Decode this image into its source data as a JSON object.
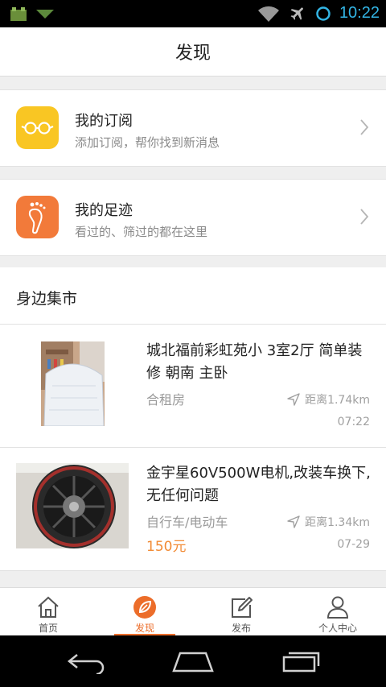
{
  "status_bar": {
    "time": "10:22"
  },
  "header": {
    "title": "发现"
  },
  "entries": [
    {
      "title": "我的订阅",
      "subtitle": "添加订阅，帮你找到新消息"
    },
    {
      "title": "我的足迹",
      "subtitle": "看过的、筛过的都在这里"
    }
  ],
  "section": {
    "title": "身边集市"
  },
  "listings": [
    {
      "title": "城北福前彩虹苑小 3室2厅 简单装修 朝南 主卧",
      "category": "合租房",
      "distance": "距离1.74km",
      "time": "07:22",
      "price": ""
    },
    {
      "title": "金宇星60V500W电机,改装车换下,无任何问题",
      "category": "自行车/电动车",
      "distance": "距离1.34km",
      "time": "07-29",
      "price": "150元"
    }
  ],
  "tabs": [
    {
      "label": "首页"
    },
    {
      "label": "发现"
    },
    {
      "label": "发布"
    },
    {
      "label": "个人中心"
    }
  ],
  "colors": {
    "accent": "#ec6d2a",
    "subscribe_icon": "#f9c623",
    "footprint_icon": "#f27a3a",
    "clock": "#33b5e5"
  }
}
